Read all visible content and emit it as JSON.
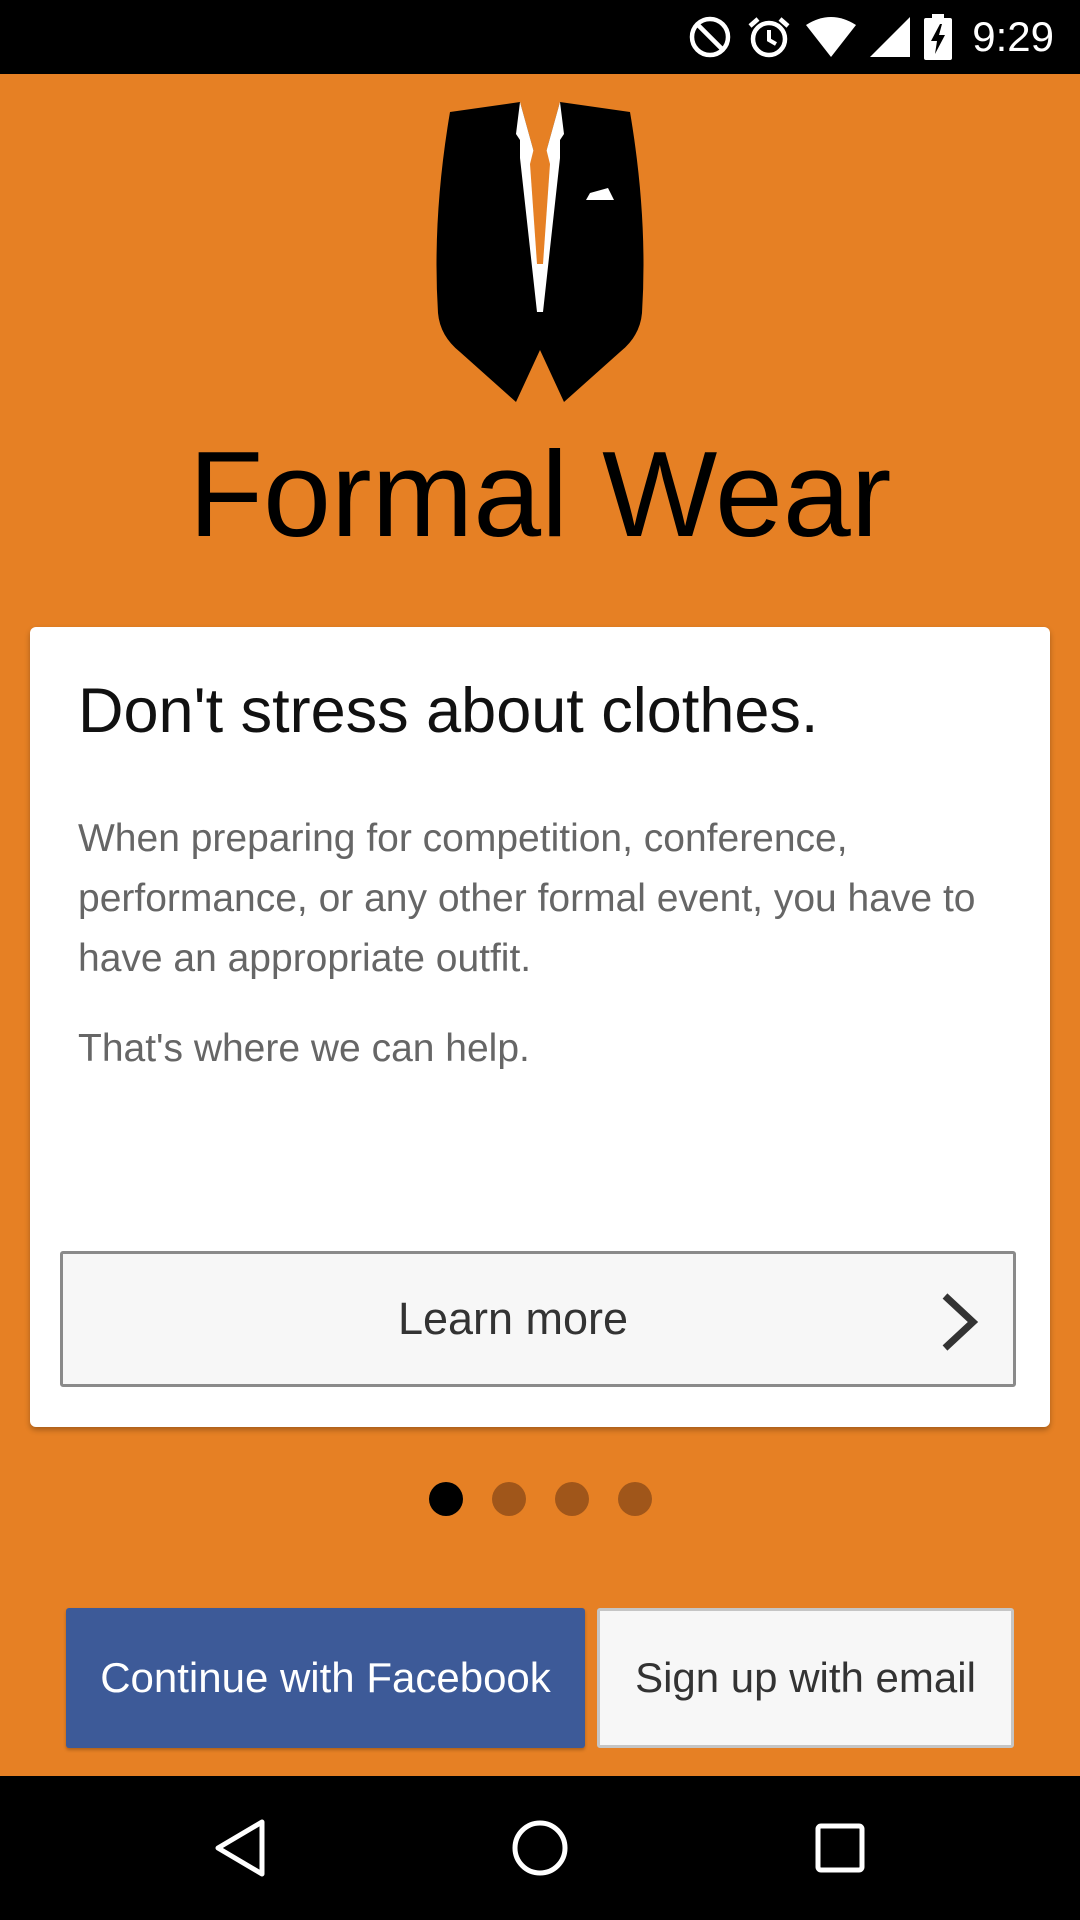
{
  "status_bar": {
    "time": "9:29",
    "icons": [
      "do-not-disturb-icon",
      "alarm-icon",
      "wifi-icon",
      "cell-signal-icon",
      "battery-charging-icon"
    ]
  },
  "app": {
    "title": "Formal Wear",
    "logo_icon": "suit-jacket-logo",
    "background_color": "#E68024"
  },
  "card": {
    "heading": "Don't stress about clothes.",
    "body": "When preparing for competition, conference, performance, or any other formal event, you have to have an appropriate outfit.",
    "body2": "That's where we can help.",
    "learn_more_label": "Learn more",
    "learn_more_icon": "chevron-right-icon"
  },
  "pager": {
    "count": 4,
    "active_index": 0
  },
  "actions": {
    "facebook_label": "Continue with Facebook",
    "facebook_color": "#3D5A98",
    "email_label": "Sign up with email"
  },
  "nav_bar": {
    "icons": [
      "back-icon",
      "home-icon",
      "recents-icon"
    ]
  }
}
